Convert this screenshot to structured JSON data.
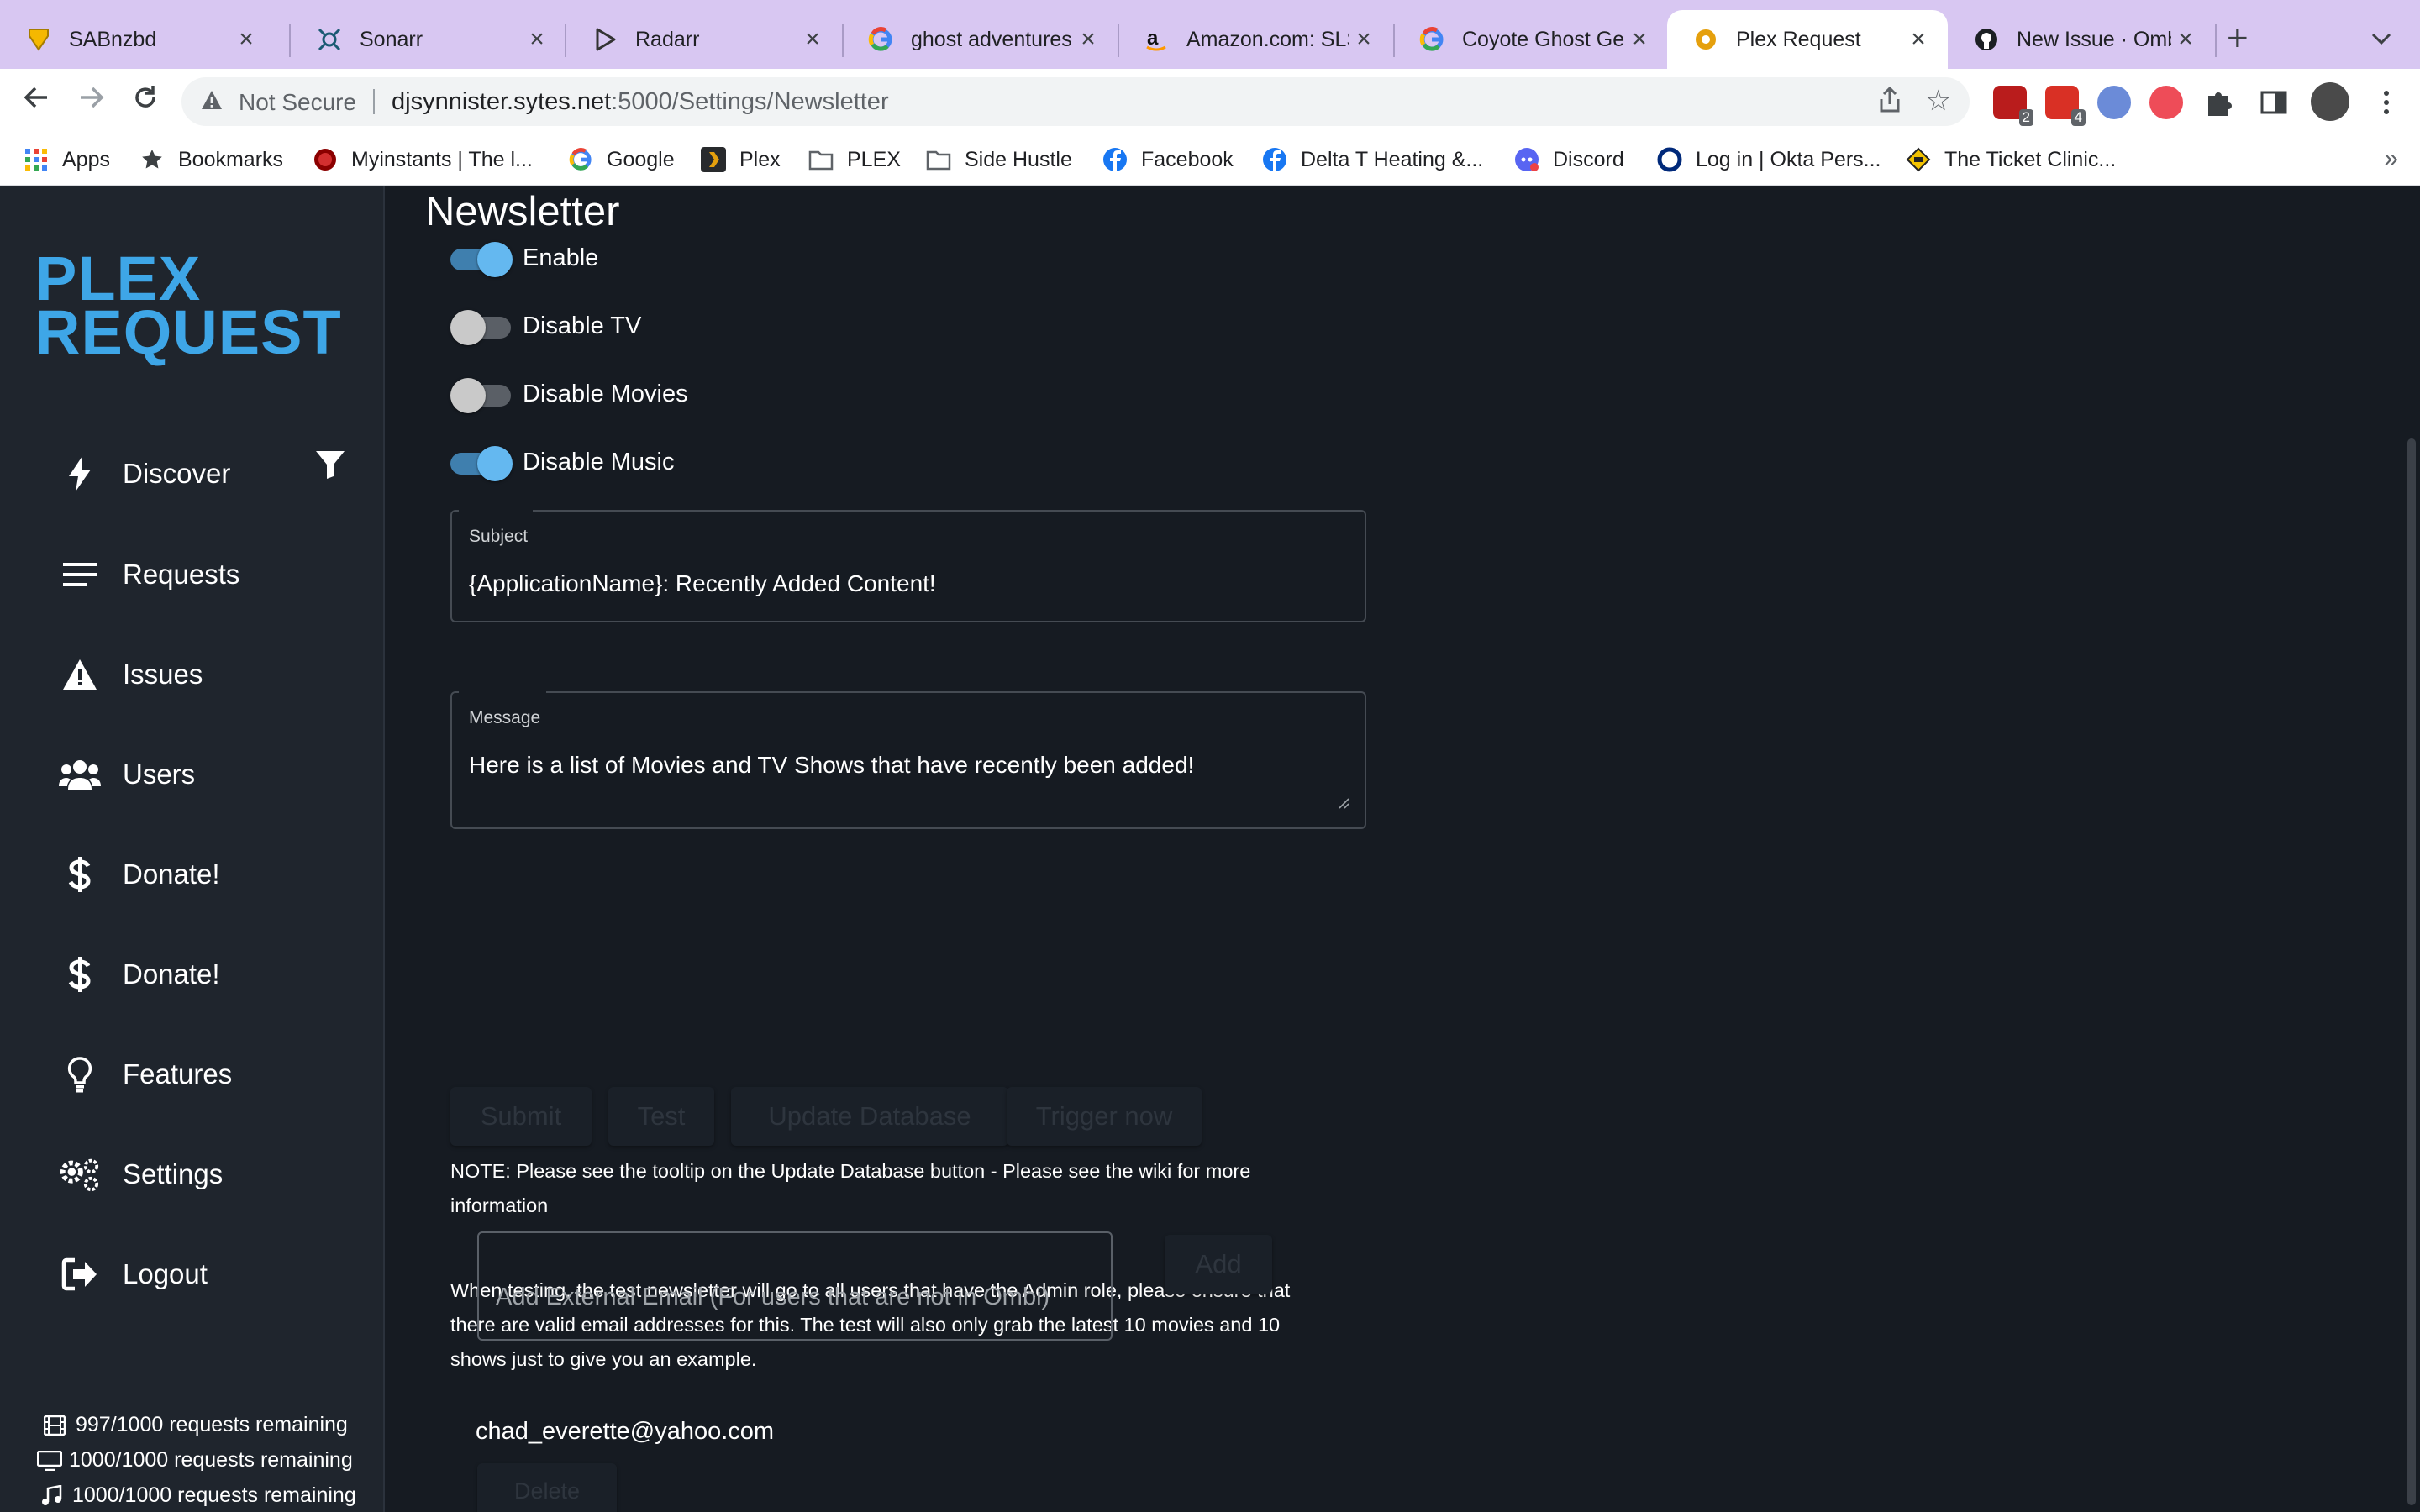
{
  "browser": {
    "tabs": [
      {
        "title": "SABnzbd",
        "icon": "sabnzbd-icon"
      },
      {
        "title": "Sonarr",
        "icon": "sonarr-icon"
      },
      {
        "title": "Radarr",
        "icon": "radarr-icon"
      },
      {
        "title": "ghost adventures",
        "icon": "google-icon"
      },
      {
        "title": "Amazon.com: SLS",
        "icon": "amazon-icon"
      },
      {
        "title": "Coyote Ghost Ge",
        "icon": "google-icon"
      },
      {
        "title": "Plex Request",
        "icon": "plex-request-icon",
        "active": true
      },
      {
        "title": "New Issue · Ombi",
        "icon": "github-icon"
      }
    ],
    "not_secure": "Not Secure",
    "url_host": "djsynnister.sytes.net",
    "url_path": ":5000/Settings/Newsletter",
    "extension_badges": [
      "2",
      "4"
    ],
    "bookmarks": [
      {
        "label": "Apps",
        "icon": "apps-grid-icon"
      },
      {
        "label": "Bookmarks",
        "icon": "star-icon"
      },
      {
        "label": "Myinstants | The l...",
        "icon": "myinstants-icon"
      },
      {
        "label": "Google",
        "icon": "google-icon"
      },
      {
        "label": "Plex",
        "icon": "plex-icon"
      },
      {
        "label": "PLEX",
        "icon": "folder-icon"
      },
      {
        "label": "Side Hustle",
        "icon": "folder-icon"
      },
      {
        "label": "Facebook",
        "icon": "facebook-icon"
      },
      {
        "label": "Delta T Heating &...",
        "icon": "facebook-icon"
      },
      {
        "label": "Discord",
        "icon": "discord-icon"
      },
      {
        "label": "Log in | Okta Pers...",
        "icon": "okta-icon"
      },
      {
        "label": "The Ticket Clinic...",
        "icon": "ticket-clinic-icon"
      }
    ]
  },
  "sidebar": {
    "logo_line1": "PLEX",
    "logo_line2": "REQUEST",
    "items": [
      {
        "label": "Discover",
        "icon": "bolt-icon"
      },
      {
        "label": "Requests",
        "icon": "list-icon"
      },
      {
        "label": "Issues",
        "icon": "warning-icon"
      },
      {
        "label": "Users",
        "icon": "users-icon"
      },
      {
        "label": "Donate!",
        "icon": "dollar-icon"
      },
      {
        "label": "Donate!",
        "icon": "dollar-icon"
      },
      {
        "label": "Features",
        "icon": "lightbulb-icon"
      },
      {
        "label": "Settings",
        "icon": "gears-icon"
      },
      {
        "label": "Logout",
        "icon": "logout-icon"
      }
    ],
    "quotas": [
      {
        "text": "997/1000 requests remaining",
        "icon": "film-icon"
      },
      {
        "text": "1000/1000 requests remaining",
        "icon": "tv-icon"
      },
      {
        "text": "1000/1000 requests remaining",
        "icon": "music-icon"
      }
    ]
  },
  "main": {
    "title": "Newsletter",
    "toggles": [
      {
        "label": "Enable",
        "on": true
      },
      {
        "label": "Disable TV",
        "on": false
      },
      {
        "label": "Disable Movies",
        "on": false
      },
      {
        "label": "Disable Music",
        "on": true
      }
    ],
    "subject": {
      "label": "Subject",
      "value": "{ApplicationName}: Recently Added Content!"
    },
    "message": {
      "label": "Message",
      "value": "Here is a list of Movies and TV Shows that have recently been added!"
    },
    "buttons": {
      "submit": "Submit",
      "test": "Test",
      "update_db": "Update Database",
      "trigger": "Trigger now"
    },
    "note1": "NOTE: Please see the tooltip on the Update Database button - Please see the wiki for more information",
    "note2": "When testing, the test newsletter will go to all users that have the Admin role, please ensure that there are valid email addresses for this. The test will also only grab the latest 10 movies and 10 shows just to give you an example.",
    "external_email_placeholder": "Add External Email (For users that are not in Ombi)",
    "add_label": "Add",
    "emails": [
      "chad_everette@yahoo.com"
    ],
    "delete_label": "Delete"
  },
  "colors": {
    "accent": "#3ea6e7",
    "sidebar_bg": "#1f252d",
    "main_bg": "#161b22",
    "tabstrip_bg": "#d8c7f2"
  }
}
